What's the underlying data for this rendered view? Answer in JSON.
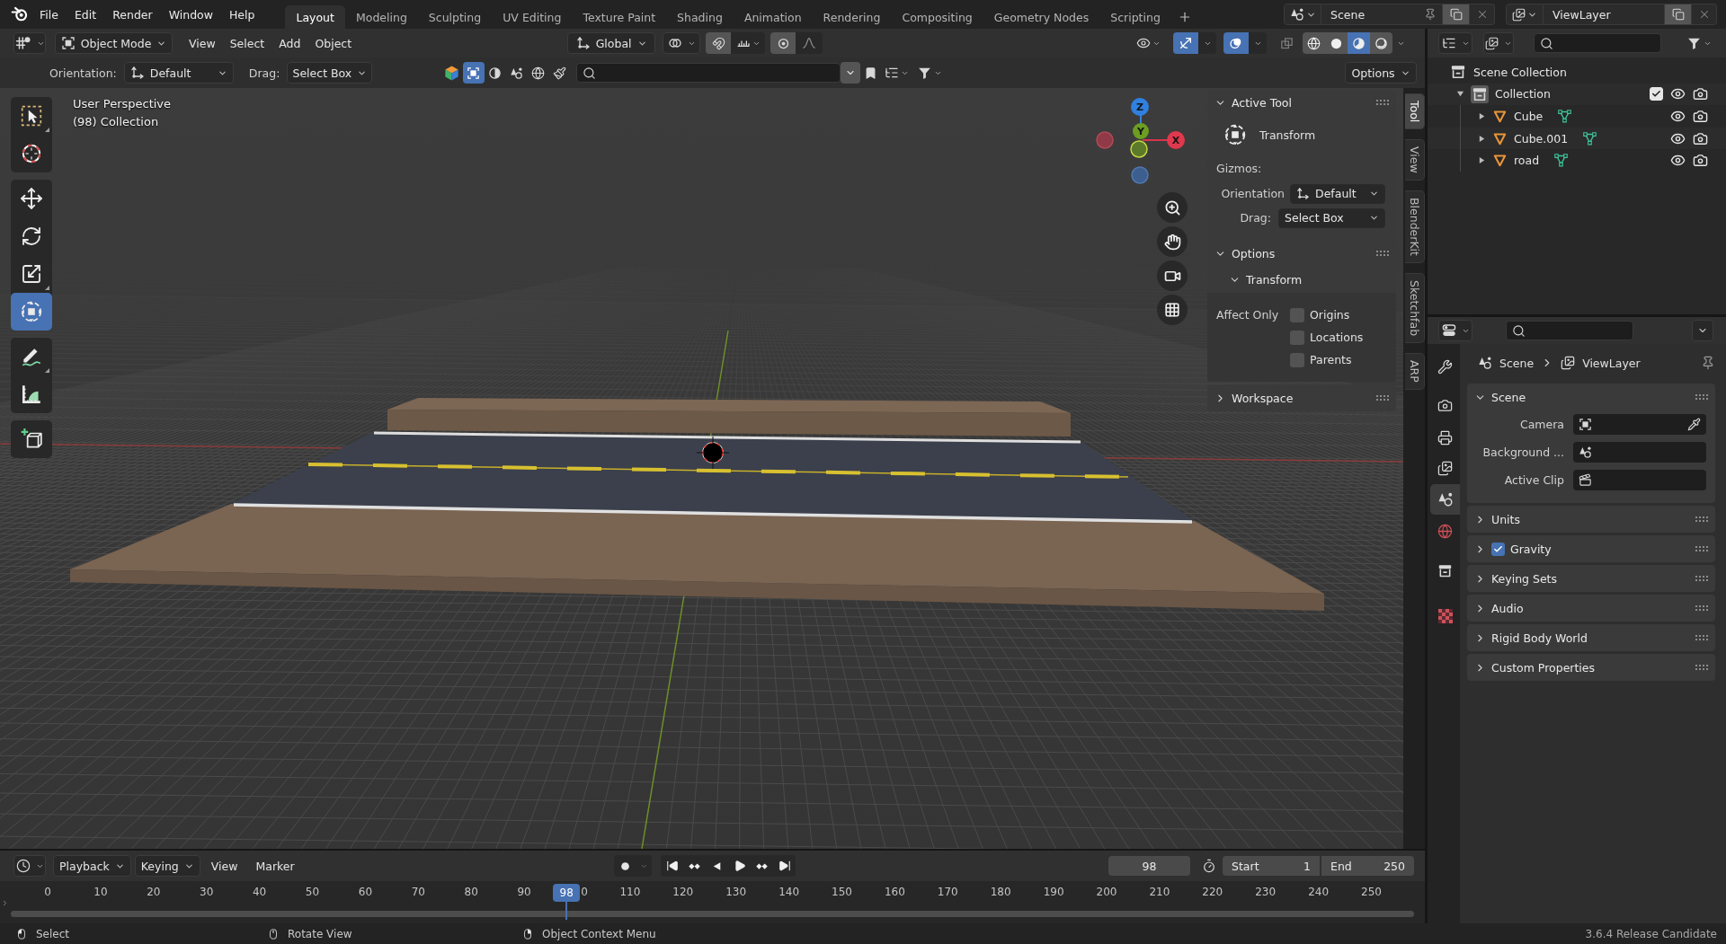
{
  "top_bar": {
    "menus": [
      "File",
      "Edit",
      "Render",
      "Window",
      "Help"
    ],
    "workspaces": [
      {
        "label": "Layout",
        "selected": true
      },
      {
        "label": "Modeling",
        "selected": false
      },
      {
        "label": "Sculpting",
        "selected": false
      },
      {
        "label": "UV Editing",
        "selected": false
      },
      {
        "label": "Texture Paint",
        "selected": false
      },
      {
        "label": "Shading",
        "selected": false
      },
      {
        "label": "Animation",
        "selected": false
      },
      {
        "label": "Rendering",
        "selected": false
      },
      {
        "label": "Compositing",
        "selected": false
      },
      {
        "label": "Geometry Nodes",
        "selected": false
      },
      {
        "label": "Scripting",
        "selected": false
      }
    ],
    "scene": "Scene",
    "view_layer": "ViewLayer"
  },
  "viewport_header": {
    "mode": "Object Mode",
    "menus": [
      "View",
      "Select",
      "Add",
      "Object"
    ],
    "orientation": "Global",
    "snapping": false,
    "proportional_editing": false,
    "gizmos": true,
    "overlays": true,
    "xray": false,
    "shading": [
      {
        "kind": "wireframe",
        "selected": false
      },
      {
        "kind": "solid",
        "selected": false
      },
      {
        "kind": "material",
        "selected": true
      },
      {
        "kind": "rendered",
        "selected": false
      }
    ]
  },
  "tool_settings": {
    "orientation_label": "Orientation:",
    "orientation": "Default",
    "drag_label": "Drag:",
    "drag": "Select Box",
    "asset_types": [
      {
        "kind": "model",
        "selected": true
      },
      {
        "kind": "material",
        "selected": false
      },
      {
        "kind": "scene",
        "selected": false
      },
      {
        "kind": "hdr",
        "selected": false
      },
      {
        "kind": "brush",
        "selected": false
      }
    ],
    "options": "Options"
  },
  "viewport": {
    "view_name": "User Perspective",
    "collection_info": "(98) Collection",
    "tool_groups": [
      {
        "tools": [
          {
            "kind": "select_box",
            "selected": false
          },
          {
            "kind": "cursor",
            "selected": false
          }
        ]
      },
      {
        "tools": [
          {
            "kind": "move",
            "selected": false
          },
          {
            "kind": "rotate",
            "selected": false
          },
          {
            "kind": "scale",
            "selected": false
          },
          {
            "kind": "transform",
            "selected": true
          }
        ]
      },
      {
        "tools": [
          {
            "kind": "annotate",
            "selected": false
          },
          {
            "kind": "measure",
            "selected": false
          }
        ]
      },
      {
        "tools": [
          {
            "kind": "add_cube",
            "selected": false
          }
        ]
      }
    ],
    "gizmo": {
      "x": "X",
      "y": "Y",
      "z": "Z"
    }
  },
  "sidebar": {
    "active_tool": {
      "title": "Active Tool",
      "expanded": true,
      "tool": "Transform",
      "gizmos_label": "Gizmos:",
      "orientation_label": "Orientation",
      "orientation": "Default",
      "drag_label": "Drag:",
      "drag": "Select Box"
    },
    "options": {
      "title": "Options",
      "expanded": true,
      "transform": {
        "title": "Transform",
        "expanded": true,
        "affect_only_label": "Affect Only",
        "checkboxes": [
          {
            "label": "Origins",
            "checked": false
          },
          {
            "label": "Locations",
            "checked": false
          },
          {
            "label": "Parents",
            "checked": false
          }
        ]
      }
    },
    "workspace": {
      "title": "Workspace",
      "expanded": false
    },
    "tabs": [
      {
        "label": "Tool",
        "selected": true
      },
      {
        "label": "View",
        "selected": false
      },
      {
        "label": "BlenderKit",
        "selected": false
      },
      {
        "label": "Sketchfab",
        "selected": false
      },
      {
        "label": "ARP",
        "selected": false
      }
    ]
  },
  "outliner": {
    "root": {
      "label": "Scene Collection",
      "children": [
        {
          "label": "Collection",
          "kind": "collection",
          "expanded": true,
          "active": true,
          "included": true,
          "visible": true,
          "renderable": true,
          "children": [
            {
              "label": "Cube",
              "kind": "mesh",
              "expanded": false,
              "visible": true,
              "renderable": true
            },
            {
              "label": "Cube.001",
              "kind": "mesh",
              "expanded": false,
              "visible": true,
              "renderable": true
            },
            {
              "label": "road",
              "kind": "mesh",
              "expanded": false,
              "visible": true,
              "renderable": true
            }
          ]
        }
      ]
    }
  },
  "properties": {
    "tabs": [
      {
        "kind": "tool",
        "selected": false
      },
      {
        "kind": "render",
        "selected": false
      },
      {
        "kind": "output",
        "selected": false
      },
      {
        "kind": "view_layer",
        "selected": false
      },
      {
        "kind": "scene",
        "selected": true
      },
      {
        "kind": "world",
        "selected": false
      },
      {
        "kind": "collection",
        "selected": false
      },
      {
        "kind": "texture",
        "selected": false
      }
    ],
    "breadcrumb": [
      "Scene",
      "ViewLayer"
    ],
    "panels": [
      {
        "title": "Scene",
        "kind": "plain",
        "expanded": true,
        "fields": [
          {
            "label": "Camera",
            "kind": "camera"
          },
          {
            "label": "Background ...",
            "kind": "scene"
          },
          {
            "label": "Active Clip",
            "kind": "clip"
          }
        ]
      },
      {
        "title": "Units",
        "kind": "plain",
        "expanded": false
      },
      {
        "title": "Gravity",
        "kind": "toggle",
        "checked": true,
        "expanded": false
      },
      {
        "title": "Keying Sets",
        "kind": "plain",
        "expanded": false
      },
      {
        "title": "Audio",
        "kind": "plain",
        "expanded": false
      },
      {
        "title": "Rigid Body World",
        "kind": "plain",
        "expanded": false
      },
      {
        "title": "Custom Properties",
        "kind": "plain",
        "expanded": false
      }
    ]
  },
  "timeline": {
    "menus": [
      {
        "label": "Playback",
        "kind": "dropdown"
      },
      {
        "label": "Keying",
        "kind": "dropdown"
      },
      {
        "label": "View",
        "kind": "menu"
      },
      {
        "label": "Marker",
        "kind": "menu"
      }
    ],
    "auto_keying": false,
    "current_frame": "98",
    "start_label": "Start",
    "start": "1",
    "end_label": "End",
    "end": "250",
    "playhead": "98",
    "ticks": [
      "0",
      "10",
      "20",
      "30",
      "40",
      "50",
      "60",
      "70",
      "80",
      "90",
      "0",
      "110",
      "120",
      "130",
      "140",
      "150",
      "160",
      "170",
      "180",
      "190",
      "200",
      "210",
      "220",
      "230",
      "240",
      "250"
    ]
  },
  "status_bar": {
    "hints": [
      {
        "kind": "left_click",
        "label": "Select"
      },
      {
        "kind": "middle_click",
        "label": "Rotate View"
      },
      {
        "kind": "right_click",
        "label": "Object Context Menu"
      }
    ],
    "version": "3.6.4 Release Candidate"
  }
}
